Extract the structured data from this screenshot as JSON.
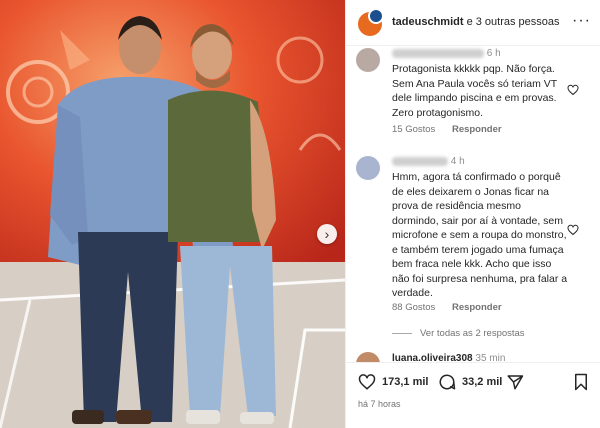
{
  "header": {
    "username": "tadeuschmidt",
    "rest": " e 3 outras pessoas",
    "more_icon": "more-horizontal-icon"
  },
  "comments": [
    {
      "time": "6 h",
      "text": "Protagonista kkkkk pqp. Não força. Sem Ana Paula vocês só teriam VT dele limpando piscina e em provas. Zero protagonismo.",
      "likes": "15 Gostos",
      "reply": "Responder"
    },
    {
      "time": "4 h",
      "text": "Hmm, agora tá confirmado o porquê de eles deixarem o Jonas ficar na prova de residência mesmo dormindo, sair por aí à vontade, sem microfone e sem a roupa do monstro, e também terem jogado uma fumaça bem fraca nele kkk. Acho que isso não foi surpresa nenhuma, pra falar a verdade.",
      "likes": "88 Gostos",
      "reply": "Responder",
      "view_replies": "Ver todas as 2 respostas"
    },
    {
      "username": "luana.oliveira308",
      "time": "35 min"
    }
  ],
  "actions": {
    "likes": "173,1 mil",
    "comments": "33,2 mil",
    "timestamp": "há 7 horas"
  },
  "colors": {
    "studio_red": "#e5482b",
    "shirt_blue": "#7f9cc6",
    "tank_olive": "#5c6a3b"
  }
}
